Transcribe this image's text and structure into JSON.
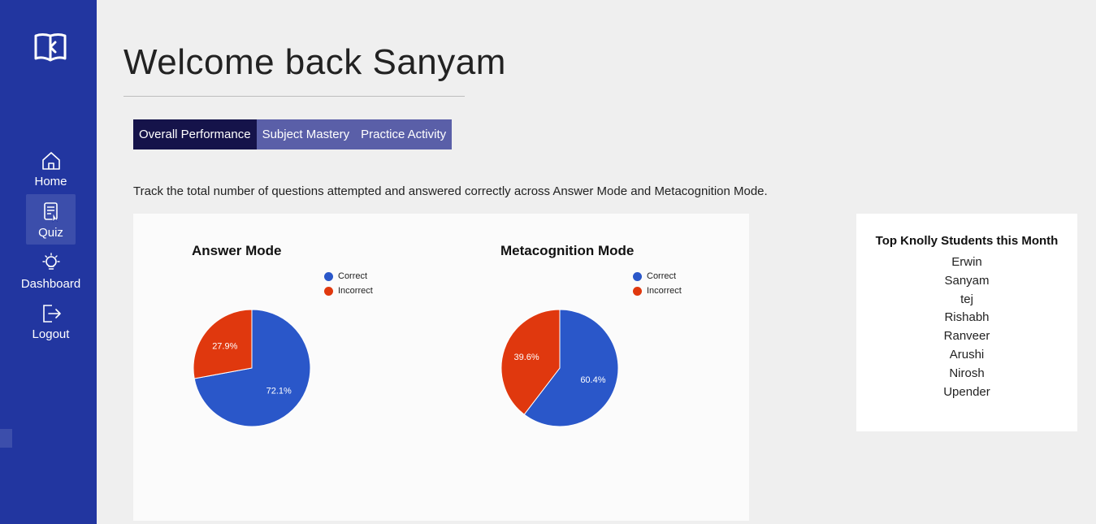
{
  "sidebar": {
    "items": [
      {
        "label": "Home",
        "icon": "home-icon"
      },
      {
        "label": "Quiz",
        "icon": "quiz-icon"
      },
      {
        "label": "Dashboard",
        "icon": "lightbulb-icon"
      },
      {
        "label": "Logout",
        "icon": "logout-icon"
      }
    ],
    "active": "Quiz"
  },
  "header": {
    "title": "Welcome back Sanyam"
  },
  "tabs": [
    {
      "label": "Overall Performance",
      "active": true
    },
    {
      "label": "Subject Mastery",
      "active": false
    },
    {
      "label": "Practice Activity",
      "active": false
    }
  ],
  "description": "Track the total number of questions attempted and answered correctly across Answer Mode and Metacognition Mode.",
  "colors": {
    "sidebar": "#2236a0",
    "tab_active": "#15134a",
    "tab_inactive": "#5a5fa8",
    "correct": "#2a57c9",
    "incorrect": "#e0380e"
  },
  "chart_data": [
    {
      "type": "pie",
      "title": "Answer Mode",
      "categories": [
        "Correct",
        "Incorrect"
      ],
      "values": [
        72.1,
        27.9
      ],
      "labels": [
        "72.1%",
        "27.9%"
      ],
      "legend": "top-right"
    },
    {
      "type": "pie",
      "title": "Metacognition Mode",
      "categories": [
        "Correct",
        "Incorrect"
      ],
      "values": [
        60.4,
        39.6
      ],
      "labels": [
        "60.4%",
        "39.6%"
      ],
      "legend": "top-right"
    }
  ],
  "leaderboard": {
    "title": "Top Knolly Students this Month",
    "students": [
      "Erwin",
      "Sanyam",
      "tej",
      "Rishabh",
      "Ranveer",
      "Arushi",
      "Nirosh",
      "Upender"
    ]
  }
}
